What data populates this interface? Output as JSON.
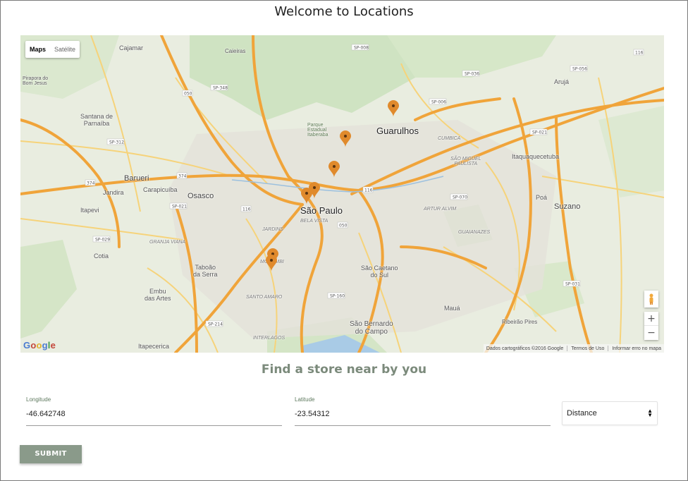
{
  "page": {
    "title": "Welcome to Locations"
  },
  "map": {
    "type_buttons": {
      "maps": "Maps",
      "satellite": "Satélite"
    },
    "google_logo": "Google",
    "attribution": {
      "data": "Dados cartográficos ©2016 Google",
      "terms": "Termos de Uso",
      "report": "Informar erro no mapa"
    },
    "zoom": {
      "in": "+",
      "out": "−"
    },
    "places": {
      "sao_paulo": "São Paulo",
      "guarulhos": "Guarulhos",
      "osasco": "Osasco",
      "barueri": "Barueri",
      "carapicuiba": "Carapicuíba",
      "jandira": "Jandira",
      "itapevi": "Itapevi",
      "cotia": "Cotia",
      "taboao": "Taboão\nda Serra",
      "embu": "Embu\ndas Artes",
      "itapecerica": "Itapecerica",
      "santana": "Santana de\nParnaíba",
      "cajamar": "Cajamar",
      "caieiras": "Caieiras",
      "aruja": "Arujá",
      "itaquaquecetuba": "Itaquaquecetuba",
      "poa": "Poá",
      "suzano": "Suzano",
      "maua": "Mauá",
      "sao_caetano": "São Caetano\ndo Sul",
      "sao_bernardo": "São Bernardo\ndo Campo",
      "ribeirao": "Ribeirão Pires",
      "pirapora": "Pirapora do\nBom Jesus",
      "bela_vista": "BELA VISTA",
      "jardins": "JARDINS",
      "artur_alvim": "ARTUR ALVIM",
      "guaianazes": "GUAIANAZES",
      "santo_amaro": "SANTO AMARO",
      "interlagos": "INTERLAGOS",
      "granja_viana": "GRANJA VIANA",
      "cumbica": "CUMBICA",
      "sao_miguel": "SÃO MIGUEL\nPAULISTA",
      "parque": "Parque\nEstadual\nItaberaba",
      "morumbi": "MORUMBI"
    }
  },
  "form": {
    "heading": "Find a store near by you",
    "longitude": {
      "label": "Longitude",
      "value": "-46.642748"
    },
    "latitude": {
      "label": "Latitude",
      "value": "-23.54312"
    },
    "distance": {
      "selected": "Distance"
    },
    "submit_label": "SUBMIT"
  },
  "colors": {
    "marker": "#e08a2c",
    "submit_bg": "#8a9a8a",
    "heading": "#7b8a7b",
    "road_major": "#f2a93b",
    "road_minor": "#f6cf66"
  },
  "icons": {
    "marker": "map-marker-icon",
    "pegman": "street-view-icon"
  }
}
